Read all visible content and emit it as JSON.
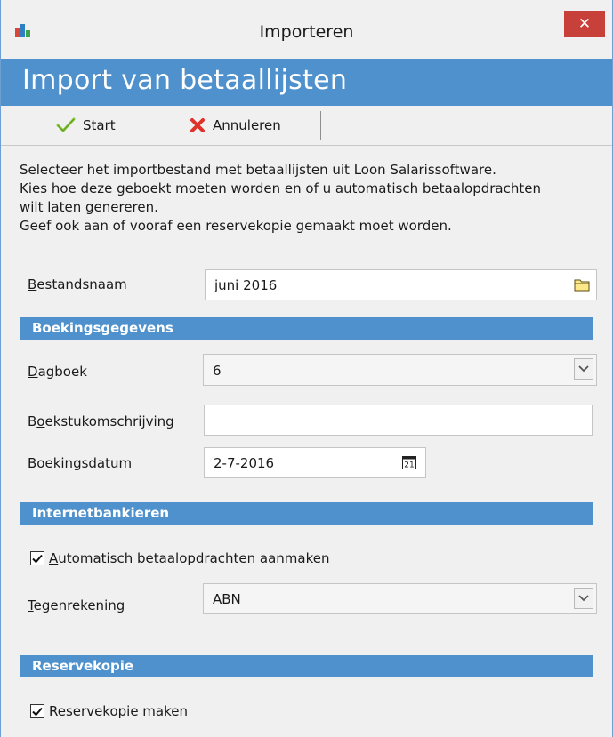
{
  "window": {
    "title": "Importeren",
    "close_label": "✕"
  },
  "banner": {
    "title": "Import van betaallijsten"
  },
  "toolbar": {
    "start_label": "Start",
    "cancel_label": "Annuleren"
  },
  "description": {
    "lines": [
      "Selecteer het importbestand met betaallijsten uit Loon Salarissoftware.",
      "Kies hoe deze geboekt moeten worden en of u automatisch betaalopdrachten",
      "wilt laten genereren.",
      "Geef ook aan of vooraf een reservekopie gemaakt moet worden."
    ]
  },
  "fields": {
    "bestandsnaam": {
      "label_key": "B",
      "label_rest": "estandsnaam",
      "value": "juni 2016"
    }
  },
  "boekingsgegevens": {
    "header": "Boekingsgegevens",
    "dagboek": {
      "label_key": "D",
      "label_rest": "agboek",
      "value": "6"
    },
    "boekstuk": {
      "label_pre": "B",
      "label_key": "o",
      "label_rest": "ekstukomschrijving",
      "value": ""
    },
    "boekingsdatum": {
      "label_pre": "Bo",
      "label_key": "e",
      "label_rest": "kingsdatum",
      "value": "2-7-2016"
    }
  },
  "internetbankieren": {
    "header": "Internetbankieren",
    "auto_checkbox": {
      "label_key": "A",
      "label_rest": "utomatisch betaalopdrachten aanmaken",
      "checked": true
    },
    "tegenrekening": {
      "label_key": "T",
      "label_rest": "egenrekening",
      "value": "ABN"
    }
  },
  "reservekopie": {
    "header": "Reservekopie",
    "checkbox": {
      "label_key": "R",
      "label_rest": "eservekopie maken",
      "checked": true
    }
  },
  "icons": {
    "app": "bar-chart-icon",
    "start": "checkmark-icon",
    "cancel": "red-x-icon",
    "browse": "folder-icon",
    "calendar": "calendar-icon",
    "dropdown": "chevron-down-icon"
  },
  "colors": {
    "accent": "#4f91cc",
    "close": "#c7403a"
  }
}
